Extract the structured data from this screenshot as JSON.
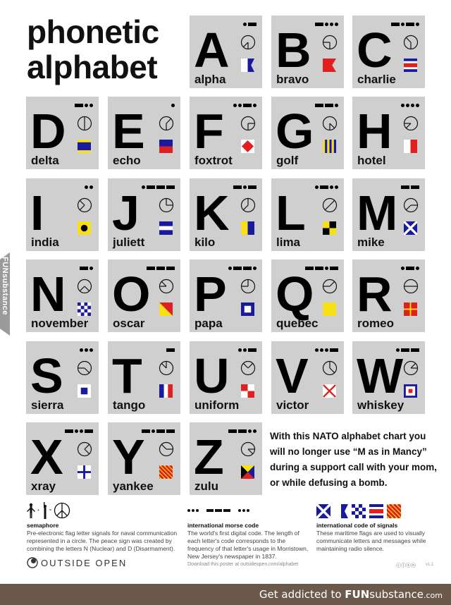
{
  "title_line1": "phonetic",
  "title_line2": "alphabet",
  "watermark": "FUNsubstance",
  "tiles": [
    {
      "letter": "A",
      "word": "alpha",
      "morse": ".-",
      "sema": [
        "S",
        "SW"
      ],
      "flag": "alpha"
    },
    {
      "letter": "B",
      "word": "bravo",
      "morse": "-...",
      "sema": [
        "S",
        "W"
      ],
      "flag": "bravo"
    },
    {
      "letter": "C",
      "word": "charlie",
      "morse": "-.-.",
      "sema": [
        "S",
        "NW"
      ],
      "flag": "charlie"
    },
    {
      "letter": "D",
      "word": "delta",
      "morse": "-..",
      "sema": [
        "S",
        "N"
      ],
      "flag": "delta"
    },
    {
      "letter": "E",
      "word": "echo",
      "morse": ".",
      "sema": [
        "S",
        "NE"
      ],
      "flag": "echo"
    },
    {
      "letter": "F",
      "word": "foxtrot",
      "morse": "..-.",
      "sema": [
        "S",
        "E"
      ],
      "flag": "foxtrot"
    },
    {
      "letter": "G",
      "word": "golf",
      "morse": "--.",
      "sema": [
        "S",
        "SE"
      ],
      "flag": "golf"
    },
    {
      "letter": "H",
      "word": "hotel",
      "morse": "....",
      "sema": [
        "SW",
        "W"
      ],
      "flag": "hotel"
    },
    {
      "letter": "I",
      "word": "india",
      "morse": "..",
      "sema": [
        "SW",
        "NW"
      ],
      "flag": "india"
    },
    {
      "letter": "J",
      "word": "juliett",
      "morse": ".---",
      "sema": [
        "N",
        "E"
      ],
      "flag": "juliett"
    },
    {
      "letter": "K",
      "word": "kilo",
      "morse": "-.-",
      "sema": [
        "SW",
        "N"
      ],
      "flag": "kilo"
    },
    {
      "letter": "L",
      "word": "lima",
      "morse": ".-..",
      "sema": [
        "SW",
        "NE"
      ],
      "flag": "lima"
    },
    {
      "letter": "M",
      "word": "mike",
      "morse": "--",
      "sema": [
        "SW",
        "E"
      ],
      "flag": "mike"
    },
    {
      "letter": "N",
      "word": "november",
      "morse": "-.",
      "sema": [
        "SW",
        "SE"
      ],
      "flag": "november"
    },
    {
      "letter": "O",
      "word": "oscar",
      "morse": "---",
      "sema": [
        "W",
        "NW"
      ],
      "flag": "oscar"
    },
    {
      "letter": "P",
      "word": "papa",
      "morse": ".--.",
      "sema": [
        "W",
        "N"
      ],
      "flag": "papa"
    },
    {
      "letter": "Q",
      "word": "quebec",
      "morse": "--.-",
      "sema": [
        "W",
        "NE"
      ],
      "flag": "quebec"
    },
    {
      "letter": "R",
      "word": "romeo",
      "morse": ".-.",
      "sema": [
        "W",
        "E"
      ],
      "flag": "romeo"
    },
    {
      "letter": "S",
      "word": "sierra",
      "morse": "...",
      "sema": [
        "W",
        "SE"
      ],
      "flag": "sierra"
    },
    {
      "letter": "T",
      "word": "tango",
      "morse": "-",
      "sema": [
        "NW",
        "N"
      ],
      "flag": "tango"
    },
    {
      "letter": "U",
      "word": "uniform",
      "morse": "..-",
      "sema": [
        "NW",
        "NE"
      ],
      "flag": "uniform"
    },
    {
      "letter": "V",
      "word": "victor",
      "morse": "...-",
      "sema": [
        "N",
        "SE"
      ],
      "flag": "victor"
    },
    {
      "letter": "W",
      "word": "whiskey",
      "morse": ".--",
      "sema": [
        "NE",
        "E"
      ],
      "flag": "whiskey"
    },
    {
      "letter": "X",
      "word": "xray",
      "morse": "-..-",
      "sema": [
        "NE",
        "SE"
      ],
      "flag": "xray"
    },
    {
      "letter": "Y",
      "word": "yankee",
      "morse": "-.--",
      "sema": [
        "NW",
        "E"
      ],
      "flag": "yankee"
    },
    {
      "letter": "Z",
      "word": "zulu",
      "morse": "--..",
      "sema": [
        "E",
        "SE"
      ],
      "flag": "zulu"
    }
  ],
  "tagline": "With this NATO alphabet chart you will no longer use “M as in Mancy” during a support call with your mom, or while defusing a bomb.",
  "footer": {
    "semaphore": {
      "title": "semaphore",
      "text": "Pre-electronic flag letter signals for naval communication represented in a circle. The peace sign was created by combining the letters N (Nuclear) and D (Disarmament)."
    },
    "morse": {
      "title": "international morse code",
      "text": "The world's first digital code. The length of each letter's code corresponds to the frequency of that letter's usage in Morristown, New Jersey's newspaper in 1837.",
      "example": "... --- ..."
    },
    "signals": {
      "title": "international code of signals",
      "text": "These maritime flags are used to visually communicate letters and messages while maintaining radio silence.",
      "example_flags": [
        "mike",
        "alpha",
        "november",
        "charlie",
        "yankee"
      ]
    },
    "logo": "OUTSIDE OPEN",
    "download": "Download this poster at outsideopen.com/alphabet",
    "license_icons": "ⓒⓘⓢⓝ",
    "version": "v1.1"
  },
  "colors": {
    "tile_bg": "#cfcfcf",
    "flag_blue": "#1a1a9e",
    "flag_red": "#e02020",
    "flag_yellow": "#f7e017",
    "bottom_bar": "#6b5a4b"
  },
  "bottom_bar": {
    "prefix": "Get addicted to ",
    "brand_bold": "FUN",
    "brand_rest": "substance",
    "suffix": ".com"
  }
}
